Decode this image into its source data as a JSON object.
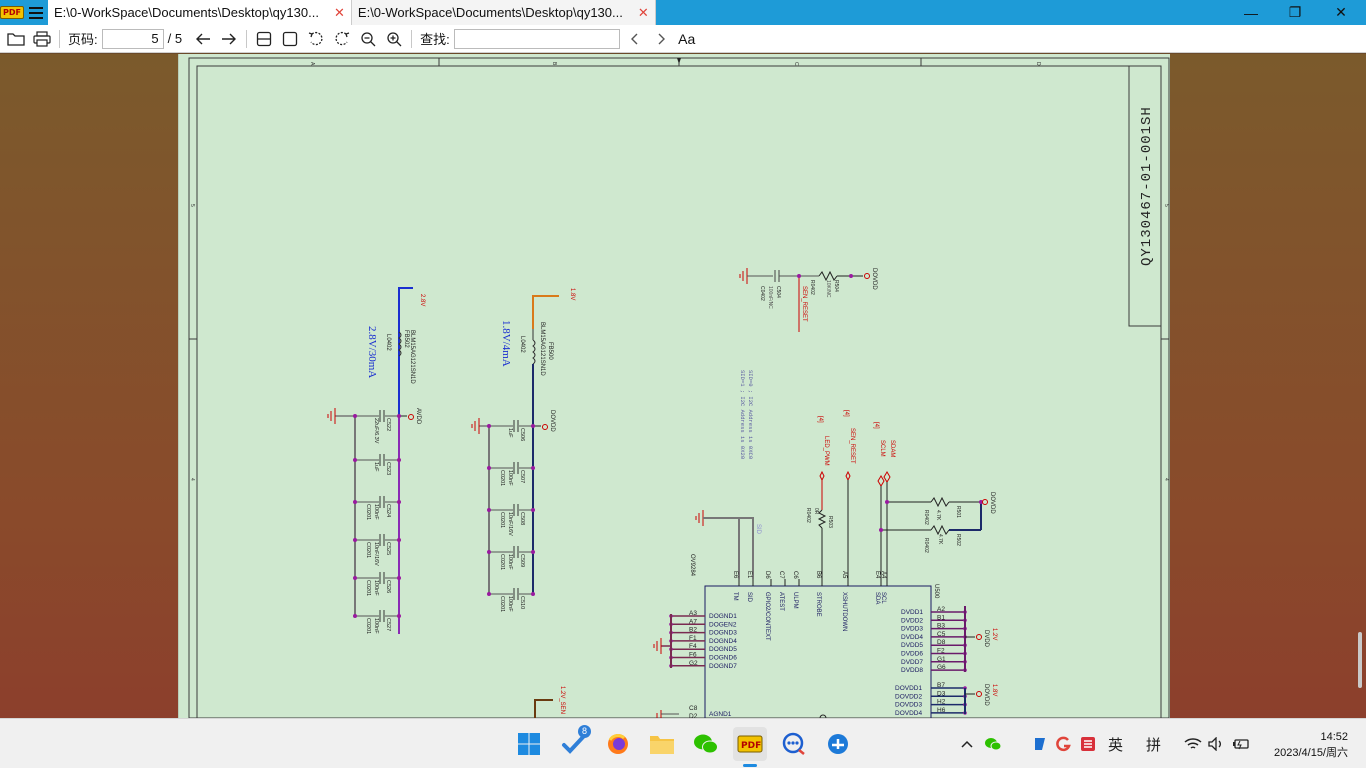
{
  "tabs": [
    {
      "title": "E:\\0-WorkSpace\\Documents\\Desktop\\qy130...",
      "close": "✕"
    },
    {
      "title": "E:\\0-WorkSpace\\Documents\\Desktop\\qy130...",
      "close": "✕"
    }
  ],
  "app_badge": "PDF",
  "window_controls": {
    "minimize": "—",
    "maximize": "❐",
    "close": "✕"
  },
  "toolbar": {
    "page_label": "页码:",
    "page_current": "5",
    "page_total": "/ 5",
    "find_label": "查找:",
    "find_value": "",
    "font_button": "Aa"
  },
  "schematic": {
    "drawing_number": "QY130467-01-001SH",
    "col_markers": [
      "A",
      "B",
      "C",
      "D"
    ],
    "row_markers": [
      "5",
      "4"
    ],
    "nets": {
      "v28": "2.8V",
      "v18": "1.8V",
      "v12": "1.2V",
      "v12_sen": "1.2V_SEN",
      "avdd": "AVDD",
      "dovdd": "DOVDD",
      "dvdd": "DVDD",
      "sen_reset": "SEN_RESET",
      "led_pwm": "LED_PWM",
      "sdam": "SDAM",
      "sclm": "SCLM",
      "page_ref": "[4]"
    },
    "ferrites": {
      "fb502_ref": "FB502",
      "fb502_part": "BLM15AG121SN1D",
      "fb502_pkg": "L0402",
      "fb502_note": "2.8V/30mA",
      "fb500_ref": "FB500",
      "fb500_part": "BLM15AG121SN1D",
      "fb500_pkg": "L0402",
      "fb500_note": "1.8V/4mA"
    },
    "caps_avdd": [
      {
        "ref": "C522",
        "val": "22uF/6.3V"
      },
      {
        "ref": "C523",
        "val": "1uF"
      },
      {
        "ref": "C524",
        "val": "100nF"
      },
      {
        "ref": "C525",
        "val": "10nF/16V"
      },
      {
        "ref": "C526",
        "val": "100nF"
      },
      {
        "ref": "C527",
        "val": "100nF"
      }
    ],
    "caps_dovdd": [
      {
        "ref": "C506",
        "val": "1uF"
      },
      {
        "ref": "C507",
        "val": "100nF"
      },
      {
        "ref": "C508",
        "val": "10nF/16V"
      },
      {
        "ref": "C509",
        "val": "100nF"
      },
      {
        "ref": "C510",
        "val": "100nF"
      }
    ],
    "pkg_0201": "C0201",
    "pkg_0402": "C0402",
    "reset_rc": {
      "c504": "C504",
      "c504_val": "100nF/NC",
      "r504": "R504",
      "r504_val": "10K/NC",
      "r0402": "R0402"
    },
    "r503": {
      "ref": "R503",
      "val": "0R",
      "pkg": "R0402"
    },
    "r501": {
      "ref": "R501",
      "val": "4.7K",
      "pkg": "R0402"
    },
    "r502": {
      "ref": "R502",
      "val": "4.7K",
      "pkg": "R0402"
    },
    "sid_note1": "SID=0 ; I2C Address is 0XC0",
    "sid_note2": "SID=1 ; I2C Address is 0X20",
    "sid_net": "SID",
    "chip": {
      "name": "OV9284",
      "ref": "U500",
      "top_pins": [
        {
          "num": "E6",
          "name": "TM"
        },
        {
          "num": "E1",
          "name": "SID"
        },
        {
          "num": "D6",
          "name": "GPIO2/CONTEXT"
        },
        {
          "num": "C7",
          "name": "ATEST"
        },
        {
          "num": "C6",
          "name": "ULPM"
        },
        {
          "num": "B6",
          "name": "STROBE"
        },
        {
          "num": "A5",
          "name": "XSHUTDOWN"
        },
        {
          "num": "E4",
          "name": "SDA"
        },
        {
          "num": "A4",
          "name": "SCL"
        }
      ],
      "left_pins": [
        {
          "num": "A3",
          "name": "DOGND1"
        },
        {
          "num": "A7",
          "name": "DOGEN2"
        },
        {
          "num": "B2",
          "name": "DOGND3"
        },
        {
          "num": "F1",
          "name": "DOGND4"
        },
        {
          "num": "F4",
          "name": "DOGND5"
        },
        {
          "num": "F6",
          "name": "DOGND6"
        },
        {
          "num": "G2",
          "name": "DOGND7"
        }
      ],
      "agnd": {
        "num": "C8",
        "num2": "D2",
        "name": "AGND1"
      },
      "right_pins": [
        {
          "num": "A2",
          "name": "DVDD1"
        },
        {
          "num": "B1",
          "name": "DVDD2"
        },
        {
          "num": "B3",
          "name": "DVDD3"
        },
        {
          "num": "C5",
          "name": "DVDD4"
        },
        {
          "num": "D8",
          "name": "DVDD5"
        },
        {
          "num": "F2",
          "name": "DVDD6"
        },
        {
          "num": "G1",
          "name": "DVDD7"
        },
        {
          "num": "G6",
          "name": "DVDD8"
        }
      ],
      "right_pins2": [
        {
          "num": "B7",
          "name": "DOVDD1"
        },
        {
          "num": "D3",
          "name": "DOVDD2"
        },
        {
          "num": "H2",
          "name": "DOVDD3"
        },
        {
          "num": "H6",
          "name": "DOVDD4"
        }
      ]
    }
  },
  "taskbar": {
    "badge_count": "8",
    "ime_lang": "英",
    "ime_mode": "拼",
    "time": "14:52",
    "date": "2023/4/15/周六"
  }
}
